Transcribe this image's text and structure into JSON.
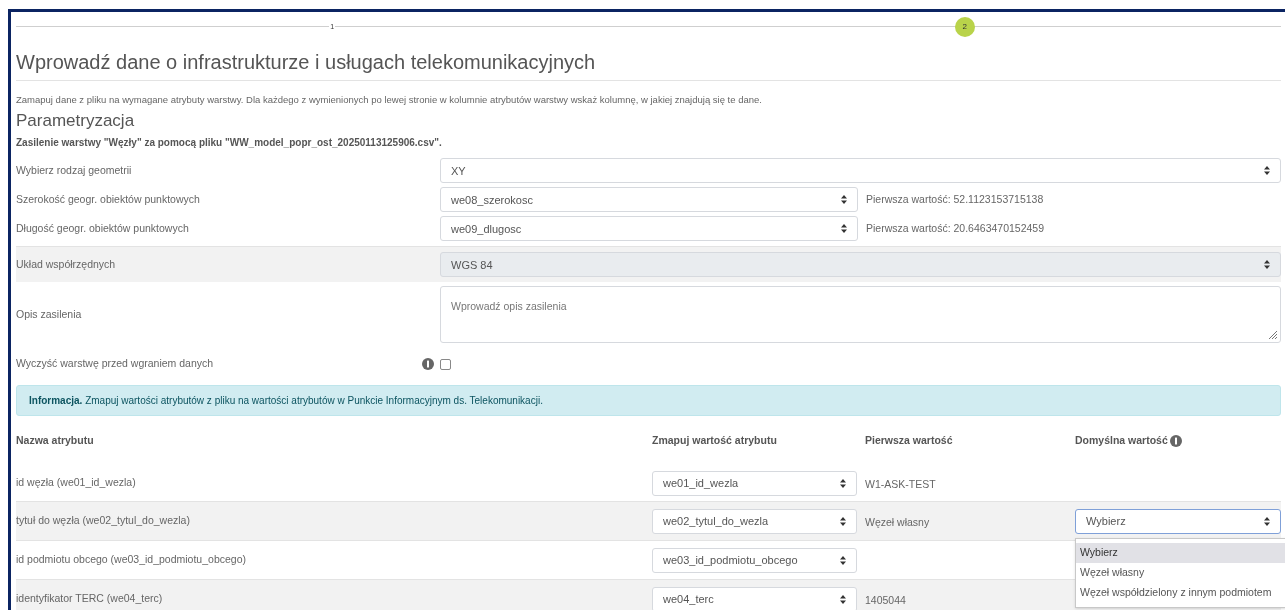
{
  "stepper": [
    {
      "label": "1",
      "active": false
    },
    {
      "label": "2",
      "active": true
    }
  ],
  "title": "Wprowadź dane o infrastrukturze i usługach telekomunikacyjnych",
  "intro": "Zamapuj dane z pliku na wymagane atrybuty warstwy. Dla każdego z wymienionych po lewej stronie w kolumnie atrybutów warstwy wskaż kolumnę, w jakiej znajdują się te dane.",
  "section_title": "Parametryzacja",
  "source_note": "Zasilenie warstwy \"Węzły\" za pomocą pliku \"WW_model_popr_ost_20250113125906.csv\".",
  "form_rows": [
    {
      "kind": "select",
      "label": "Wybierz rodzaj geometrii",
      "value": "XY",
      "disabled": false
    },
    {
      "kind": "select",
      "label": "Szerokość geogr. obiektów punktowych",
      "value": "we08_szerokosc",
      "hint": "Pierwsza wartość: 52.1123153715138",
      "disabled": false
    },
    {
      "kind": "select",
      "label": "Długość geogr. obiektów punktowych",
      "value": "we09_dlugosc",
      "hint": "Pierwsza wartość: 20.6463470152459",
      "disabled": false
    },
    {
      "kind": "select",
      "label": "Układ współrzędnych",
      "value": "WGS 84",
      "disabled": true
    },
    {
      "kind": "textarea",
      "label": "Opis zasilenia",
      "placeholder": "Wprowadź opis zasilenia"
    },
    {
      "kind": "checkbox",
      "label": "Wyczyść warstwę przed wgraniem danych",
      "checked": false,
      "info": true
    }
  ],
  "info_box": "**Informacja.** Zmapuj wartości atrybutów z pliku na wartości atrybutów w Punkcie Informacyjnym ds. Telekomunikacji.",
  "table": {
    "columns": [
      {
        "label": "Nazwa atrybutu",
        "info": false
      },
      {
        "label": "Zmapuj wartość atrybutu",
        "info": false
      },
      {
        "label": "Pierwsza wartość",
        "info": false
      },
      {
        "label": "Domyślna wartość",
        "info": true
      }
    ],
    "rows": [
      {
        "name": "id węzła (we01_id_wezla)",
        "mapped": "we01_id_wezla",
        "first_value": "W1-ASK-TEST"
      },
      {
        "name": "tytuł do węzła (we02_tytul_do_wezla)",
        "mapped": "we02_tytul_do_wezla",
        "first_value": "Węzeł własny",
        "default": {
          "value": "Wybierz",
          "open": true,
          "options": [
            {
              "label": "Wybierz",
              "selected": true
            },
            {
              "label": "Węzeł własny",
              "selected": false
            },
            {
              "label": "Węzeł współdzielony z innym podmiotem",
              "selected": false
            }
          ]
        }
      },
      {
        "name": "id podmiotu obcego (we03_id_podmiotu_obcego)",
        "mapped": "we03_id_podmiotu_obcego"
      },
      {
        "name": "identyfikator TERC (we04_terc)",
        "mapped": "we04_terc",
        "first_value": "1405044"
      }
    ]
  }
}
